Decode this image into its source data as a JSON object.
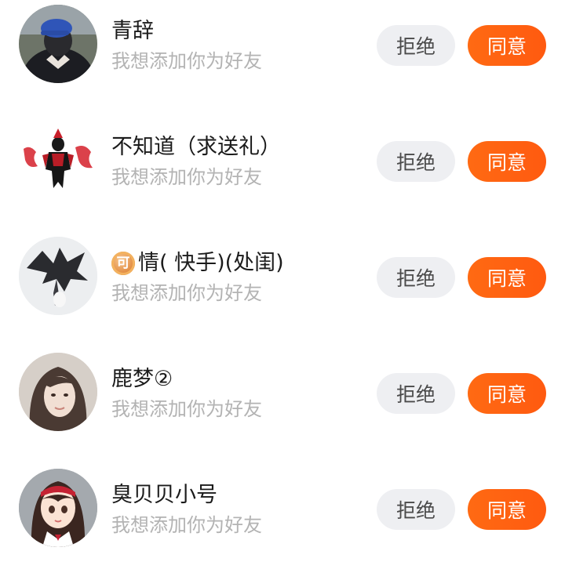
{
  "requests": [
    {
      "name": "青辞",
      "badge": "",
      "subtitle": "我想添加你为好友",
      "reject_label": "拒绝",
      "accept_label": "同意",
      "avatar": "person-cap"
    },
    {
      "name": "不知道（求送礼）",
      "badge": "",
      "subtitle": "我想添加你为好友",
      "reject_label": "拒绝",
      "accept_label": "同意",
      "avatar": "hero-figure"
    },
    {
      "name": "情( 快手)(处闺)",
      "badge": "可",
      "subtitle": "我想添加你为好友",
      "reject_label": "拒绝",
      "accept_label": "同意",
      "avatar": "dragon"
    },
    {
      "name": "鹿梦②",
      "badge": "",
      "subtitle": "我想添加你为好友",
      "reject_label": "拒绝",
      "accept_label": "同意",
      "avatar": "girl-photo"
    },
    {
      "name": "臭贝贝小号",
      "badge": "",
      "subtitle": "我想添加你为好友",
      "reject_label": "拒绝",
      "accept_label": "同意",
      "avatar": "anime-girl"
    }
  ],
  "colors": {
    "accept_button": "#ff6012",
    "reject_button": "#eeeff2",
    "subtitle_text": "#b3b3b3",
    "name_text": "#1b1b1b"
  }
}
